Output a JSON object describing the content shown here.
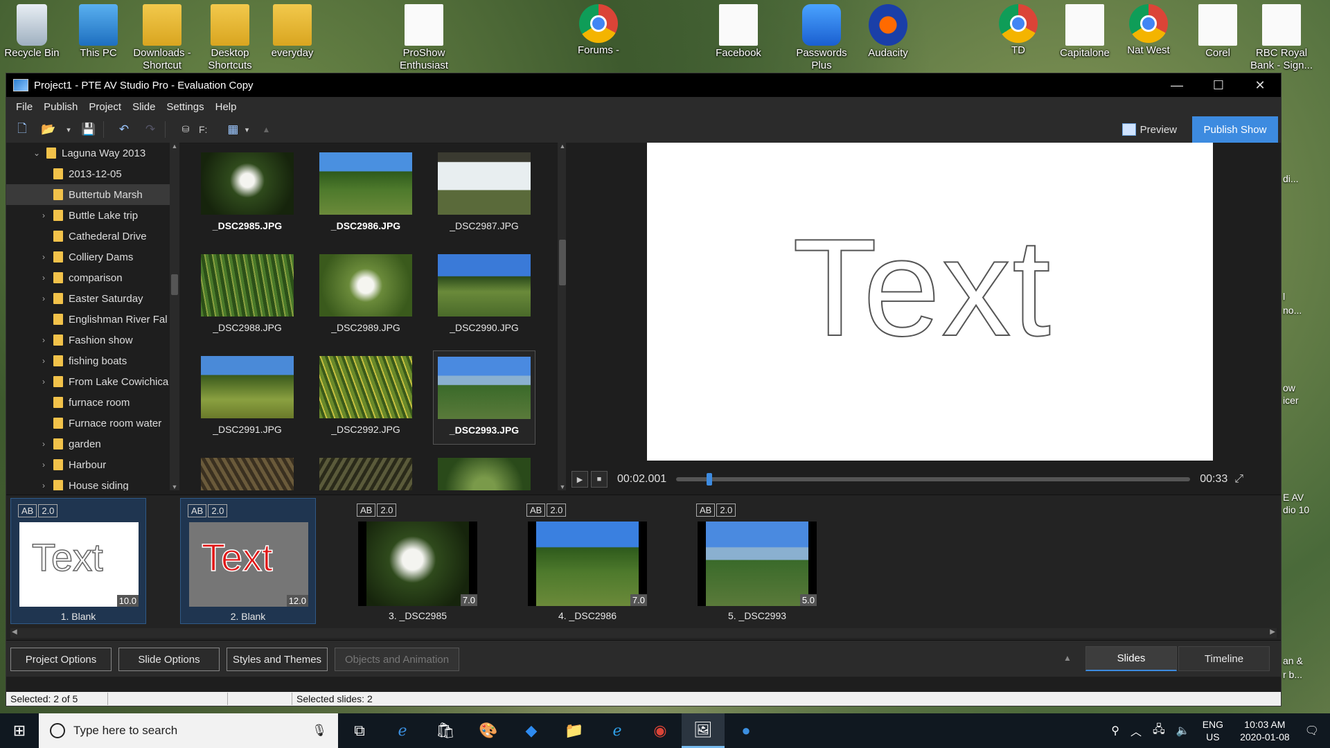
{
  "desktop": {
    "icons": [
      {
        "name": "recycle-bin",
        "l1": "Recycle Bin",
        "l2": ""
      },
      {
        "name": "this-pc",
        "l1": "This PC",
        "l2": ""
      },
      {
        "name": "downloads-shortcut",
        "l1": "Downloads -",
        "l2": "Shortcut"
      },
      {
        "name": "desktop-shortcuts",
        "l1": "Desktop",
        "l2": "Shortcuts"
      },
      {
        "name": "everyday",
        "l1": "everyday",
        "l2": ""
      },
      {
        "name": "proshow",
        "l1": "ProShow",
        "l2": "Enthusiast"
      },
      {
        "name": "forums",
        "l1": "Forums -",
        "l2": ""
      },
      {
        "name": "facebook",
        "l1": "Facebook",
        "l2": ""
      },
      {
        "name": "passwords-plus",
        "l1": "Passwords",
        "l2": "Plus"
      },
      {
        "name": "audacity",
        "l1": "Audacity",
        "l2": ""
      },
      {
        "name": "td",
        "l1": "TD",
        "l2": ""
      },
      {
        "name": "capitalone",
        "l1": "Capitalone",
        "l2": ""
      },
      {
        "name": "nat-west",
        "l1": "Nat West",
        "l2": ""
      },
      {
        "name": "corel",
        "l1": "Corel",
        "l2": ""
      },
      {
        "name": "rbc",
        "l1": "RBC Royal",
        "l2": "Bank - Sign..."
      }
    ],
    "right_edge": [
      "di...",
      "l",
      "no...",
      "ow",
      "icer",
      "E AV",
      "dio 10",
      "an &",
      "r b..."
    ]
  },
  "window": {
    "title": "Project1 - PTE AV Studio Pro - Evaluation Copy",
    "controls": {
      "minimize": "—",
      "maximize": "☐",
      "close": "✕"
    }
  },
  "menu": [
    "File",
    "Publish",
    "Project",
    "Slide",
    "Settings",
    "Help"
  ],
  "toolbar": {
    "drive": "F:",
    "preview": "Preview",
    "publish": "Publish Show"
  },
  "tree": {
    "items": [
      {
        "label": "Laguna Way 2013",
        "chev": "⌄",
        "indent": 0,
        "selected": false
      },
      {
        "label": "2013-12-05",
        "chev": "",
        "indent": 1,
        "selected": false
      },
      {
        "label": "Buttertub Marsh",
        "chev": "",
        "indent": 1,
        "selected": true
      },
      {
        "label": "Buttle Lake trip",
        "chev": "›",
        "indent": 1,
        "selected": false
      },
      {
        "label": "Cathederal Drive",
        "chev": "",
        "indent": 1,
        "selected": false
      },
      {
        "label": "Colliery Dams",
        "chev": "›",
        "indent": 1,
        "selected": false
      },
      {
        "label": "comparison",
        "chev": "›",
        "indent": 1,
        "selected": false
      },
      {
        "label": "Easter Saturday",
        "chev": "›",
        "indent": 1,
        "selected": false
      },
      {
        "label": "Englishman River Fal",
        "chev": "",
        "indent": 1,
        "selected": false
      },
      {
        "label": "Fashion show",
        "chev": "›",
        "indent": 1,
        "selected": false
      },
      {
        "label": "fishing boats",
        "chev": "›",
        "indent": 1,
        "selected": false
      },
      {
        "label": "From Lake Cowichica",
        "chev": "›",
        "indent": 1,
        "selected": false
      },
      {
        "label": "furnace room",
        "chev": "",
        "indent": 1,
        "selected": false
      },
      {
        "label": "Furnace room water",
        "chev": "",
        "indent": 1,
        "selected": false
      },
      {
        "label": "garden",
        "chev": "›",
        "indent": 1,
        "selected": false
      },
      {
        "label": "Harbour",
        "chev": "›",
        "indent": 1,
        "selected": false
      },
      {
        "label": "House siding",
        "chev": "›",
        "indent": 1,
        "selected": false
      }
    ]
  },
  "files": [
    {
      "name": "_DSC2985.JPG",
      "bold": true,
      "selected": false,
      "bg": "radial-gradient(circle at 50% 45%, #f4f4f0 0 12%, #2f4a1c 30%, #16240c 80%)"
    },
    {
      "name": "_DSC2986.JPG",
      "bold": true,
      "selected": false,
      "bg": "linear-gradient(#4a90e0 0 30%, #2e5a1c 31%, #4e7a2c 60%, #6b8a3a)"
    },
    {
      "name": "_DSC2987.JPG",
      "bold": false,
      "selected": false,
      "bg": "linear-gradient(#3a3a30 0 15%, #e8eef0 16% 60%, #5a6a3a 61%)"
    },
    {
      "name": "_DSC2988.JPG",
      "bold": false,
      "selected": false,
      "bg": "repeating-linear-gradient(80deg, #4a7a2a 0 4px, #2c5018 4px 9px, #8aa040 9px 11px)"
    },
    {
      "name": "_DSC2989.JPG",
      "bold": false,
      "selected": false,
      "bg": "radial-gradient(circle at 50% 50%, #f5f5f0 0 14%, #6a8a3a 30%, #3a5a1c 80%)"
    },
    {
      "name": "_DSC2990.JPG",
      "bold": false,
      "selected": false,
      "bg": "linear-gradient(#3a7ad8 0 35%, #2a4a1a 36%, #6a8a3a 60%, #4a6a2a)"
    },
    {
      "name": "_DSC2991.JPG",
      "bold": false,
      "selected": false,
      "bg": "linear-gradient(#4a8ad8 0 30%, #3a5a1c 31%, #8aa040 70%, #6a7a2a)"
    },
    {
      "name": "_DSC2992.JPG",
      "bold": false,
      "selected": false,
      "bg": "repeating-linear-gradient(70deg, #6a8a2a 0 5px, #3a5a1a 5px 9px, #c8c040 9px 11px)"
    },
    {
      "name": "_DSC2993.JPG",
      "bold": true,
      "selected": true,
      "bg": "linear-gradient(#4a8ae0 0 30%, #8ab0d0 31% 45%, #3a6a2a 46%, #5a7a3a)"
    },
    {
      "name": "",
      "bold": false,
      "selected": false,
      "bg": "repeating-linear-gradient(60deg,#6a5a3a 0 5px,#3a3020 5px 10px)"
    },
    {
      "name": "",
      "bold": false,
      "selected": false,
      "bg": "repeating-linear-gradient(120deg,#5a5a3a 0 5px,#2a2a1a 5px 10px)"
    },
    {
      "name": "",
      "bold": false,
      "selected": false,
      "bg": "radial-gradient(circle,#7a9a4a 20%,#2a4a1a 70%)"
    }
  ],
  "preview": {
    "text": "Text",
    "time_current": "00:02.001",
    "time_total": "00:33"
  },
  "slides": [
    {
      "ab": "AB",
      "trans": "2.0",
      "dur": "10.0",
      "caption": "1. Blank",
      "kind": "white",
      "selected": true,
      "bg": ""
    },
    {
      "ab": "AB",
      "trans": "2.0",
      "dur": "12.0",
      "caption": "2. Blank",
      "kind": "gray",
      "selected": true,
      "bg": ""
    },
    {
      "ab": "AB",
      "trans": "2.0",
      "dur": "7.0",
      "caption": "3. _DSC2985",
      "kind": "photo",
      "selected": false,
      "bg": "radial-gradient(circle at 45% 45%, #f4f4f0 0 14%, #2f4a1c 32%, #16240c 80%)"
    },
    {
      "ab": "AB",
      "trans": "2.0",
      "dur": "7.0",
      "caption": "4. _DSC2986",
      "kind": "photo",
      "selected": false,
      "bg": "linear-gradient(#3a80e0 0 30%, #2e5a1c 31%, #4e7a2c 60%, #6b8a3a)"
    },
    {
      "ab": "AB",
      "trans": "2.0",
      "dur": "5.0",
      "caption": "5. _DSC2993",
      "kind": "photo",
      "selected": false,
      "bg": "linear-gradient(#4a8ae0 0 30%, #8ab0d0 31% 45%, #3a6a2a 46%, #5a7a3a)"
    }
  ],
  "slide_text": "Text",
  "bottom": {
    "project_options": "Project Options",
    "slide_options": "Slide Options",
    "styles_themes": "Styles and Themes",
    "objects_animation": "Objects and Animation",
    "tab_slides": "Slides",
    "tab_timeline": "Timeline"
  },
  "status": {
    "selected": "Selected: 2 of 5",
    "selected_slides": "Selected slides: 2"
  },
  "taskbar": {
    "search_placeholder": "Type here to search",
    "lang1": "ENG",
    "lang2": "US",
    "time": "10:03 AM",
    "date": "2020-01-08"
  },
  "colors": {
    "accent": "#3d8be0",
    "window_bg": "#1e1e1e",
    "selected_slide": "#1f3550"
  }
}
